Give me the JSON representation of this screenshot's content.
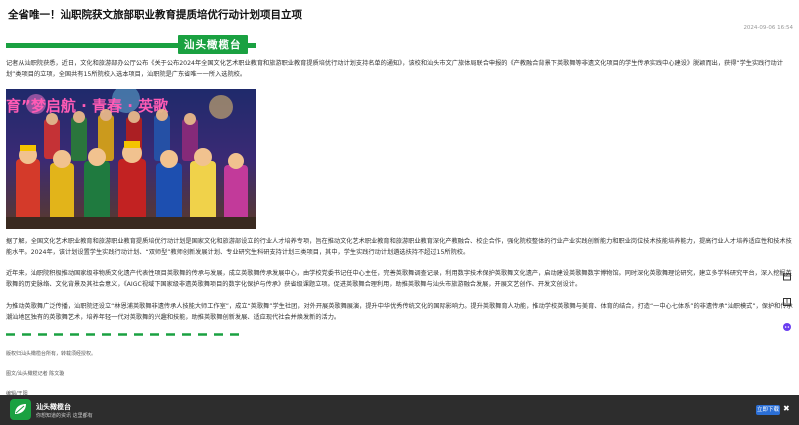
{
  "article": {
    "title": "全省唯一！汕职院获文旅部职业教育提质培优行动计划项目立项",
    "date": "2024-09-06 16:54",
    "brand_banner": "汕头橄榄台",
    "paragraphs": [
      "记者从汕职院获悉，近日，文化和旅游部办公厅公布《关于公布2024年全国文化艺术职业教育和旅游职业教育提质培优行动计划支持名单的通知》，该校和汕头市文广旅体局联合申报的《产教融合背景下英歌舞等非遗文化项目的学生传承实践中心建设》脱颖而出，获得“学生实践行动计划”类项目的立项，全国共有15所院校入选本项目，汕职院是广东省唯一一所入选院校。",
      "据了解，全国文化艺术职业教育和旅游职业教育提质培优行动计划是国家文化和旅游部设立的行业人才培养专项，旨在推动文化艺术职业教育和旅游职业教育深化产教融合、校企合作，强化院校整体的行业产业实践创新能力和职业岗位技术技能培养能力，提高行业人才培养适应性和技术技能水平。2024年，该计划设置学生实践行动计划、“双师型”教师创新发展计划、专业研究生科研支持计划三类项目，其中，学生实践行动计划遴选扶持不超过15所院校。",
      "近年来，汕职院积极推动国家级非物质文化遗产代表性项目英歌舞的传承与发展，成立英歌舞传承发展中心，由学校党委书记任中心主任，完善英歌舞调查记录，利用数字技术保护英歌舞文化遗产，启动建设英歌舞数字博物馆。同时深化英歌舞理论研究，建立多学科研究平台，深入挖掘英歌舞的历史脉络、文化背景及其社会意义，《AIGC视域下国家级非遗英歌舞项目的数字化保护与传承》获省级课题立项。促进英歌舞合理利用，助推英歌舞与汕头市旅游融合发展，开展文艺创作、开发文创设计。",
      "为推动英歌舞广泛传播，汕职院还设立“林恩浦英歌舞非遗传承人技能大师工作室”，成立“英歌舞”学生社团，对外开展英歌舞展演，提升中华优秀传统文化的国际影响力。提升英歌舞育人功能，推动学校英歌舞与美育、体育的结合，打造“一中心七体系”的非遗传承“汕职模式”，保护和传承潮汕地区独有的英歌舞艺术，培养年轻一代对英歌舞的兴趣和技能，助推英歌舞创新发展、适应现代社会并焕发新的活力。"
    ],
    "photo_banner_text": "育”梦启航 · 青春 · 英歌",
    "footnotes": [
      "版权归汕头橄榄台所有，转载须经授权。",
      "图文/汕头橄榄记者 陈文璇",
      "编辑/王阳"
    ]
  },
  "bottom_bar": {
    "app_name": "汕头橄榄台",
    "app_sub": "你想知道的资讯 这里都有",
    "download_label": "立即下载",
    "close_label": "✖"
  },
  "colors": {
    "brand_green": "#1aa141",
    "bottom_bar_bg": "#2d2d2d",
    "download_blue": "#2b6fd6"
  },
  "icons": {
    "side": [
      "share-icon",
      "book-icon",
      "robot-icon"
    ],
    "logo": "leaf-logo-icon"
  }
}
